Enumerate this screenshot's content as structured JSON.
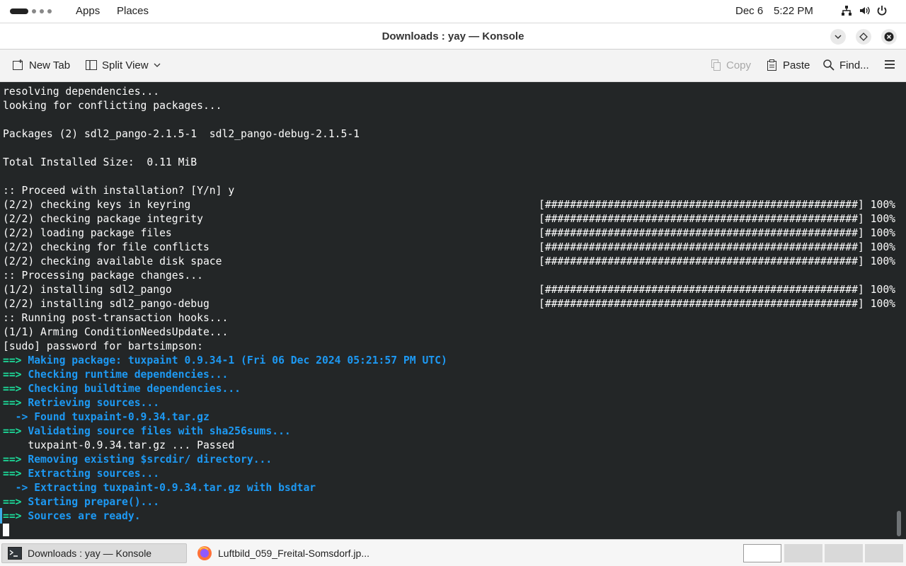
{
  "topbar": {
    "menus": [
      "Apps",
      "Places"
    ],
    "date": "Dec 6",
    "time": "5:22 PM",
    "tray_icons": [
      "network-icon",
      "volume-icon",
      "power-icon"
    ]
  },
  "window": {
    "title": "Downloads : yay — Konsole"
  },
  "toolbar": {
    "new_tab": "New Tab",
    "split_view": "Split View",
    "copy": "Copy",
    "paste": "Paste",
    "find": "Find..."
  },
  "terminal": {
    "lines": [
      {
        "type": "plain",
        "text": "resolving dependencies..."
      },
      {
        "type": "plain",
        "text": "looking for conflicting packages..."
      },
      {
        "type": "plain",
        "text": ""
      },
      {
        "type": "plain",
        "text": "Packages (2) sdl2_pango-2.1.5-1  sdl2_pango-debug-2.1.5-1"
      },
      {
        "type": "plain",
        "text": ""
      },
      {
        "type": "plain",
        "text": "Total Installed Size:  0.11 MiB"
      },
      {
        "type": "plain",
        "text": ""
      },
      {
        "type": "plain",
        "text": ":: Proceed with installation? [Y/n] y"
      },
      {
        "type": "progress",
        "text": "(2/2) checking keys in keyring",
        "bar": "[##################################################] 100%"
      },
      {
        "type": "progress",
        "text": "(2/2) checking package integrity",
        "bar": "[##################################################] 100%"
      },
      {
        "type": "progress",
        "text": "(2/2) loading package files",
        "bar": "[##################################################] 100%"
      },
      {
        "type": "progress",
        "text": "(2/2) checking for file conflicts",
        "bar": "[##################################################] 100%"
      },
      {
        "type": "progress",
        "text": "(2/2) checking available disk space",
        "bar": "[##################################################] 100%"
      },
      {
        "type": "plain",
        "text": ":: Processing package changes..."
      },
      {
        "type": "progress",
        "text": "(1/2) installing sdl2_pango",
        "bar": "[##################################################] 100%"
      },
      {
        "type": "progress",
        "text": "(2/2) installing sdl2_pango-debug",
        "bar": "[##################################################] 100%"
      },
      {
        "type": "plain",
        "text": ":: Running post-transaction hooks..."
      },
      {
        "type": "plain",
        "text": "(1/1) Arming ConditionNeedsUpdate..."
      },
      {
        "type": "plain",
        "text": "[sudo] password for bartsimpson:"
      },
      {
        "type": "arrow",
        "prefix": "==>",
        "text": " Making package: tuxpaint 0.9.34-1 (Fri 06 Dec 2024 05:21:57 PM UTC)"
      },
      {
        "type": "arrow",
        "prefix": "==>",
        "text": " Checking runtime dependencies..."
      },
      {
        "type": "arrow",
        "prefix": "==>",
        "text": " Checking buildtime dependencies..."
      },
      {
        "type": "arrow",
        "prefix": "==>",
        "text": " Retrieving sources..."
      },
      {
        "type": "sub",
        "text": "  -> Found tuxpaint-0.9.34.tar.gz"
      },
      {
        "type": "arrow",
        "prefix": "==>",
        "text": " Validating source files with sha256sums..."
      },
      {
        "type": "plain",
        "text": "    tuxpaint-0.9.34.tar.gz ... Passed"
      },
      {
        "type": "arrow",
        "prefix": "==>",
        "text": " Removing existing $srcdir/ directory..."
      },
      {
        "type": "arrow",
        "prefix": "==>",
        "text": " Extracting sources..."
      },
      {
        "type": "sub",
        "text": "  -> Extracting tuxpaint-0.9.34.tar.gz with bsdtar"
      },
      {
        "type": "arrow",
        "prefix": "==>",
        "text": " Starting prepare()..."
      },
      {
        "type": "arrow",
        "prefix": "==>",
        "text": " Sources are ready."
      }
    ]
  },
  "taskbar": {
    "tasks": [
      {
        "label": "Downloads : yay — Konsole",
        "icon": "terminal-icon",
        "active": true
      },
      {
        "label": "Luftbild_059_Freital-Somsdorf.jp...",
        "icon": "firefox-icon",
        "active": false
      }
    ],
    "workspaces": 4,
    "current_workspace": 1
  },
  "colors": {
    "terminal_bg": "#232627",
    "terminal_fg": "#fcfcfc",
    "arrow_green": "#1cdc9a",
    "message_blue": "#1d99f3"
  }
}
